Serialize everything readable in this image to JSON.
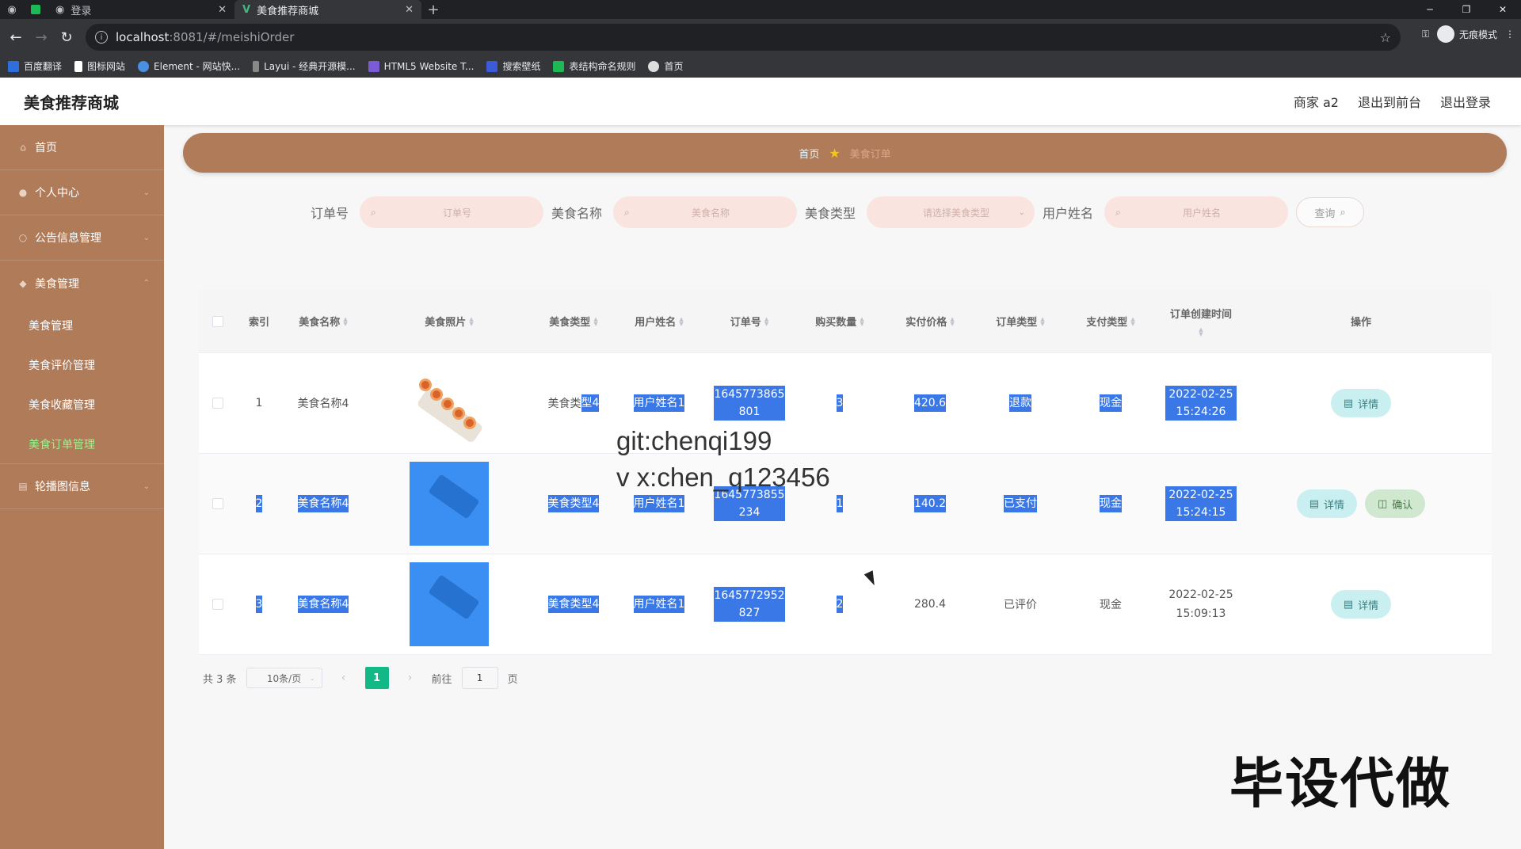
{
  "browser": {
    "tabs": [
      {
        "title": "登录"
      },
      {
        "title": "美食推荐商城"
      }
    ],
    "url_host": "localhost",
    "url_path": ":8081/#/meishiOrder",
    "incognito_label": "无痕模式",
    "bookmarks": [
      "百度翻译",
      "图标网站",
      "Element - 网站快...",
      "Layui - 经典开源模...",
      "HTML5 Website T...",
      "搜索壁纸",
      "表结构命名规则",
      "首页"
    ]
  },
  "app": {
    "title": "美食推荐商城",
    "header_links": [
      "商家 a2",
      "退出到前台",
      "退出登录"
    ]
  },
  "sidebar": {
    "items": [
      {
        "label": "首页",
        "icon": "home-icon"
      },
      {
        "label": "个人中心",
        "icon": "user-icon"
      },
      {
        "label": "公告信息管理",
        "icon": "notice-icon"
      },
      {
        "label": "美食管理",
        "icon": "food-icon"
      }
    ],
    "sub_items": [
      "美食管理",
      "美食评价管理",
      "美食收藏管理",
      "美食订单管理"
    ],
    "active_sub": "美食订单管理",
    "last_item": {
      "label": "轮播图信息",
      "icon": "carousel-icon"
    }
  },
  "breadcrumb": {
    "home": "首页",
    "current": "美食订单"
  },
  "search": {
    "order_label": "订单号",
    "order_placeholder": "订单号",
    "food_label": "美食名称",
    "food_placeholder": "美食名称",
    "type_label": "美食类型",
    "type_placeholder": "请选择美食类型",
    "user_label": "用户姓名",
    "user_placeholder": "用户姓名",
    "query_button": "查询"
  },
  "table": {
    "headers": [
      "索引",
      "美食名称",
      "美食照片",
      "美食类型",
      "用户姓名",
      "订单号",
      "购买数量",
      "实付价格",
      "订单类型",
      "支付类型",
      "订单创建时间",
      "操作"
    ],
    "rows": [
      {
        "index": "1",
        "name": "美食名称4",
        "type_a": "美食类",
        "type_b": "型4",
        "user": "用户姓名1",
        "order_no": "1645773865801",
        "qty": "3",
        "price": "420.6",
        "order_type": "退款",
        "pay_type": "现金",
        "created": "2022-02-25 15:24:26",
        "actions": [
          "详情"
        ]
      },
      {
        "index": "2",
        "name": "美食名称4",
        "type": "美食类型4",
        "user": "用户姓名1",
        "order_no": "1645773855234",
        "qty": "1",
        "price": "140.2",
        "order_type": "已支付",
        "pay_type": "现金",
        "created": "2022-02-25 15:24:15",
        "actions": [
          "详情",
          "确认"
        ]
      },
      {
        "index": "3",
        "name": "美食名称4",
        "type": "美食类型4",
        "user": "用户姓名1",
        "order_no": "1645772952827",
        "qty": "2",
        "price": "280.4",
        "order_type": "已评价",
        "pay_type": "现金",
        "created": "2022-02-25 15:09:13",
        "actions": [
          "详情"
        ]
      }
    ]
  },
  "pagination": {
    "total": "共 3 条",
    "page_size": "10条/页",
    "current": "1",
    "goto_label": "前往",
    "goto_value": "1",
    "page_suffix": "页"
  },
  "overlay": {
    "line1": "git:chenqi199",
    "line2": "v x:chen_q123456",
    "watermark": "毕设代做"
  },
  "colors": {
    "sidebar": "#b07b59",
    "accent": "#12b886",
    "highlight": "#3a78e8"
  }
}
